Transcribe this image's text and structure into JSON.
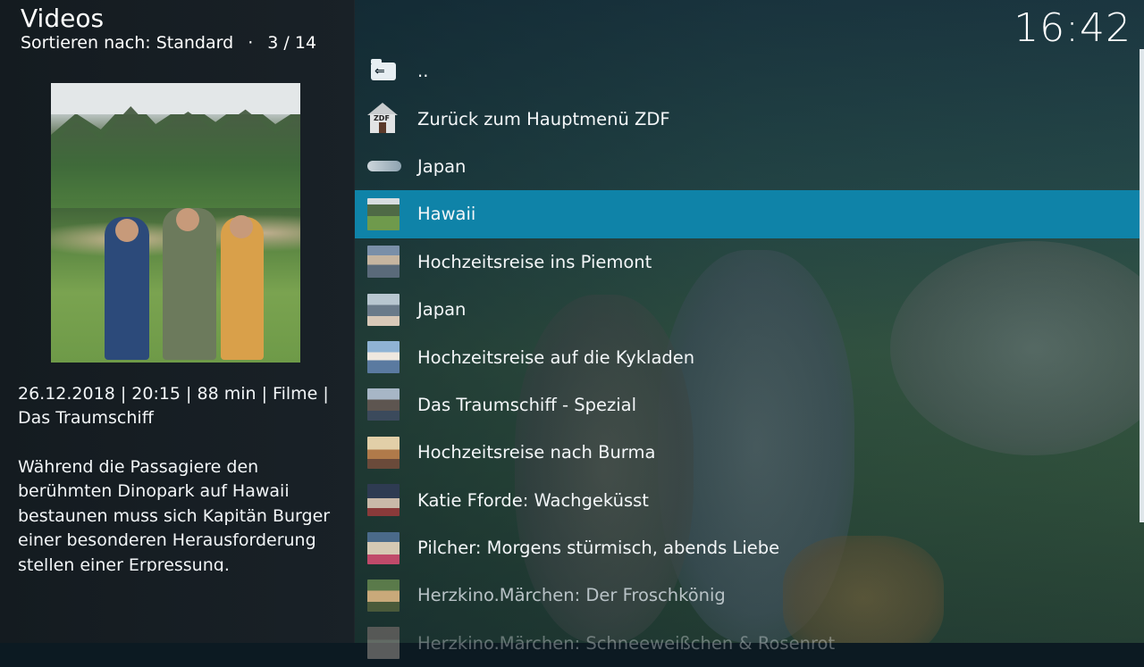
{
  "header": {
    "title": "Videos",
    "sort_label": "Sortieren nach: Standard",
    "separator": "·",
    "position": "3 / 14"
  },
  "clock": "16:42",
  "info": {
    "meta_line1": "26.12.2018 | 20:15 | 88 min | Filme |",
    "meta_line2": "Das Traumschiff",
    "plot": "Während die Passagiere den berühmten Dinopark auf Hawaii bestaunen muss sich Kapitän Burger einer besonderen Herausforderung stellen  einer Erpressung."
  },
  "list": {
    "items": [
      {
        "label": "..",
        "icon": "folder-back-icon"
      },
      {
        "label": "Zurück zum Hauptmenü ZDF",
        "icon": "zdf-home-icon"
      },
      {
        "label": "Japan",
        "icon": "airplane-thumbnail"
      },
      {
        "label": "Hawaii",
        "icon": "hawaii-thumbnail",
        "selected": true
      },
      {
        "label": "Hochzeitsreise ins Piemont",
        "icon": "thumbnail"
      },
      {
        "label": "Japan",
        "icon": "thumbnail"
      },
      {
        "label": "Hochzeitsreise auf die Kykladen",
        "icon": "thumbnail"
      },
      {
        "label": "Das Traumschiff - Spezial",
        "icon": "thumbnail"
      },
      {
        "label": "Hochzeitsreise nach Burma",
        "icon": "thumbnail"
      },
      {
        "label": "Katie Fforde: Wachgeküsst",
        "icon": "thumbnail"
      },
      {
        "label": "Pilcher: Morgens stürmisch, abends Liebe",
        "icon": "thumbnail"
      },
      {
        "label": "Herzkino.Märchen: Der Froschkönig",
        "icon": "thumbnail"
      },
      {
        "label": "Herzkino.Märchen: Schneeweißchen & Rosenrot",
        "icon": "thumbnail"
      }
    ]
  },
  "colors": {
    "selected_row": "#0f83a8",
    "panel_bg": "#161d22"
  }
}
